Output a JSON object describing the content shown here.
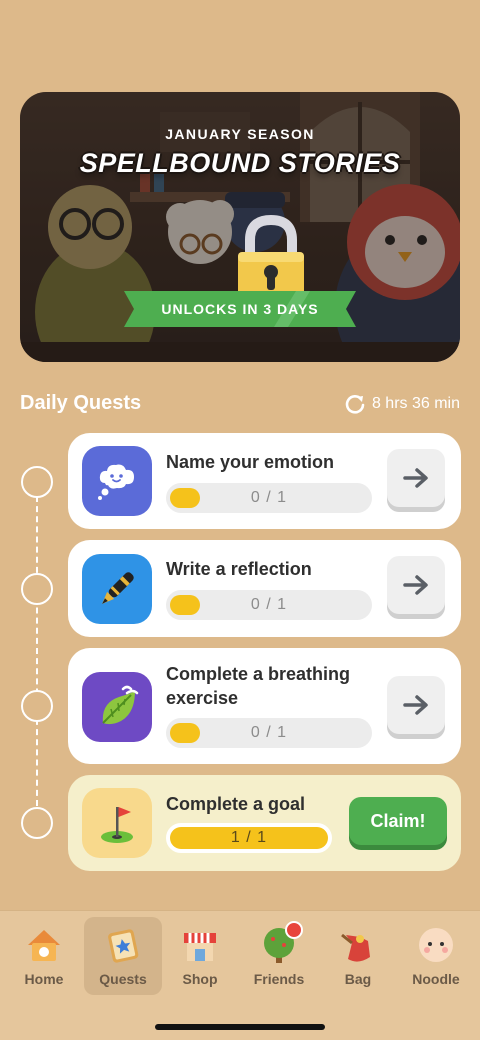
{
  "banner": {
    "eyebrow": "JANUARY SEASON",
    "title": "SPELLBOUND STORIES",
    "unlock_text": "UNLOCKS IN 3 DAYS"
  },
  "daily_quests": {
    "title": "Daily Quests",
    "timer": "8 hrs 36 min",
    "quests": [
      {
        "title": "Name your emotion",
        "progress": "0 / 1",
        "icon": "thought-bubble-icon",
        "icon_bg": "#5B6BD8",
        "action": "arrow"
      },
      {
        "title": "Write a reflection",
        "progress": "0 / 1",
        "icon": "pen-icon",
        "icon_bg": "#2F93E6",
        "action": "arrow"
      },
      {
        "title": "Complete a breathing exercise",
        "progress": "0 / 1",
        "icon": "leaf-wind-icon",
        "icon_bg": "#6E4AC4",
        "action": "arrow"
      },
      {
        "title": "Complete a goal",
        "progress": "1 / 1",
        "icon": "golf-flag-icon",
        "icon_bg": "#F8D98C",
        "action": "claim",
        "claim_label": "Claim!"
      }
    ]
  },
  "nav": {
    "items": [
      {
        "label": "Home",
        "icon": "house-icon"
      },
      {
        "label": "Quests",
        "icon": "quest-book-icon",
        "active": true
      },
      {
        "label": "Shop",
        "icon": "shop-icon"
      },
      {
        "label": "Friends",
        "icon": "tree-icon",
        "badge": true
      },
      {
        "label": "Bag",
        "icon": "bag-icon"
      },
      {
        "label": "Noodle",
        "icon": "pet-face-icon"
      }
    ]
  },
  "colors": {
    "background": "#DDB98A",
    "accent_green": "#4EAE50",
    "progress_yellow": "#F5C21B"
  }
}
